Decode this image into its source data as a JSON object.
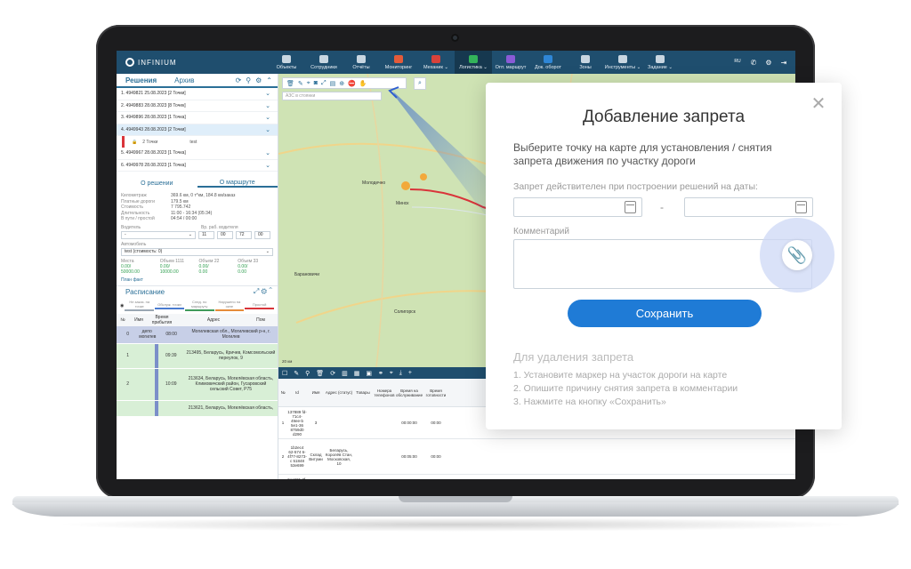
{
  "app": {
    "logo_text": "INFINIUM",
    "nav": [
      {
        "label": "Объекты",
        "color": "#c8d6e1"
      },
      {
        "label": "Сотрудники",
        "color": "#c8d6e1"
      },
      {
        "label": "Отчёты",
        "color": "#c8d6e1"
      },
      {
        "label": "Мониторинг",
        "color": "#e45b3a"
      },
      {
        "label": "Механик ⌄",
        "color": "#d8423b"
      },
      {
        "label": "Логистика ⌄",
        "color": "#33b35a"
      },
      {
        "label": "Опт. маршрут",
        "color": "#8a5bd6"
      },
      {
        "label": "Док. оборот",
        "color": "#2f86d6"
      },
      {
        "label": "Зоны",
        "color": "#c8d6e1"
      },
      {
        "label": "Инструменты ⌄",
        "color": "#c8d6e1"
      },
      {
        "label": "Задание ⌄",
        "color": "#c8d6e1"
      }
    ],
    "right_icons": {
      "lang": "RU",
      "phone": "✆",
      "settings": "⚙",
      "logout": "⇥"
    }
  },
  "left_panel": {
    "tab_solutions": "Решения",
    "tab_archive": "Архив",
    "routes": [
      "1. 4949821 25.08.2023 [2 Точки]",
      "2. 4949883 28.08.2023 [8 Точек]",
      "3. 4949896 28.08.2023 [1 Точка]",
      "4. 4949943 28.08.2023 [2 Точки]",
      "5. 4949967 28.08.2023 [1 Точка]",
      "6. 4949978 28.08.2023 [1 Точка]"
    ],
    "route_sub": {
      "points": "2 Точки",
      "name": "test"
    },
    "subtab_solution": "О решении",
    "subtab_route": "О маршруте",
    "stats": [
      {
        "k": "Километраж",
        "v": "369.6 км, 0 т*км, 184.8 км/заказ"
      },
      {
        "k": "Платные дороги",
        "v": "179.5 км"
      },
      {
        "k": "Стоимость",
        "v": "7 795.742"
      },
      {
        "k": "Длительность",
        "v": "11:00 - 16:34 (05:34)"
      },
      {
        "k": "В пути / простой",
        "v": "04:54 / 00:00"
      }
    ],
    "driver_label": "Водитель",
    "work_time_label": "Вр. раб. водителя",
    "driver_value": "-",
    "time_a": "11",
    "time_b": "00",
    "time_c": "72",
    "time_d": "00",
    "vehicle_label": "Автомобиль",
    "vehicle_value": "test (стоимость: 0)",
    "volumes": [
      {
        "k": "Места",
        "v1": "0.00/",
        "v2": "50000.00"
      },
      {
        "k": "Объем 1111",
        "v1": "0.00/",
        "v2": "10000.00"
      },
      {
        "k": "Объем 22",
        "v1": "0.00/",
        "v2": "0.00"
      },
      {
        "k": "Объем 33",
        "v1": "0.00/",
        "v2": "0.00"
      }
    ],
    "plan_fact": "План факт",
    "schedule_title": "Расписание",
    "chips": [
      "Не заказ. на точке",
      "Обслуж. точки",
      "След. по маршруту",
      "Нарушено на окне",
      "Простой"
    ],
    "table_head": [
      "№",
      "Имя",
      "Время прибытия",
      "Адрес",
      "Пом"
    ],
    "rows": [
      {
        "n": "0",
        "name": "депо могилев",
        "time": "08:00",
        "addr": "Могилевская обл., Могилевский р-н, г. Могилев"
      },
      {
        "n": "1",
        "name": "",
        "time": "09:39",
        "addr": "213495, Беларусь, Кричев, Комсомольский переулок, 9"
      },
      {
        "n": "2",
        "name": "",
        "time": "10:09",
        "addr": "213634, Беларусь, Могилёвская область, Климовичский район, Гусаровский сельский Совет, Р75"
      },
      {
        "n": "",
        "name": "",
        "time": "",
        "addr": "213621, Беларусь, Могилёвская область,"
      }
    ]
  },
  "map": {
    "select_placeholder": "АЗС в стоянки",
    "places": [
      "Барановичи",
      "Солигорск",
      "Минск",
      "Молодечно"
    ],
    "scale": "20 км"
  },
  "grid": {
    "headers": [
      "№",
      "Id",
      "Имя",
      "Адрес (статус)",
      "Товары",
      "Номера телефонов",
      "Время на обслуживание",
      "Время готовности"
    ],
    "rows": [
      {
        "n": "1",
        "id": "137889 fd-71c4-49ee-b 5e1-36 8759d0 d290",
        "name": "3",
        "addr": "",
        "t1": "00:00:00",
        "t2": "00:00"
      },
      {
        "n": "2",
        "id": "1b2ec4 62-574 6-4f77-8273-c 51848 53e699",
        "name": "Склад Витуми",
        "addr": "Беларусь, Королёв Стан, Московская, 10",
        "t1": "00:05:00",
        "t2": "00:00"
      },
      {
        "n": "3",
        "id": "5ec601 7f-320 5-45a5-ae82-7 c9d4db 20c7e",
        "name": "Евроопт",
        "addr": "Минск, Притыцкого 20",
        "t1": "00:02:00",
        "t2": "00:00",
        "t3": "23:59",
        "c1": "0",
        "c2": "00:00",
        "c3": "00:00",
        "c4": "2",
        "c5": "0",
        "c6": "0",
        "coords": "53.91258 27.49809",
        "date": "2023-08-30 1 1:45:24"
      }
    ]
  },
  "modal": {
    "title": "Добавление запрета",
    "description": "Выберите точку на карте для установления / снятия запрета движения по участку дороги",
    "date_label": "Запрет действителен при построении решений на даты:",
    "date_from": "",
    "date_to": "",
    "dash": "-",
    "comment_label": "Комментарий",
    "comment_value": "",
    "save": "Сохранить",
    "close": "✕",
    "delete_title": "Для удаления запрета",
    "delete_steps": [
      "1. Установите маркер на участок дороги на карте",
      "2. Опишите причину снятия запрета в комментарии",
      "3. Нажмите на кнопку «Сохранить»"
    ],
    "accent": "#1f7bd6"
  }
}
